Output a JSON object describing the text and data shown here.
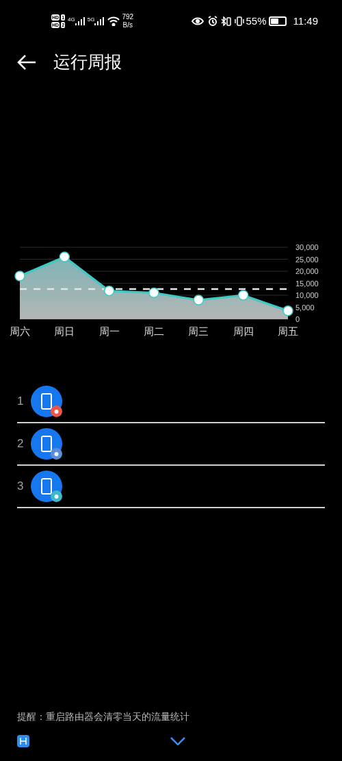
{
  "status_bar": {
    "sim": [
      {
        "label": "HD",
        "slot": "1"
      },
      {
        "label": "HD",
        "slot": "2"
      }
    ],
    "signals": [
      "4G",
      "5G"
    ],
    "speed_value": "792",
    "speed_unit": "B/s",
    "battery_text": "55%",
    "time": "11:49"
  },
  "header": {
    "title": "运行周报"
  },
  "chart_data": {
    "type": "area",
    "categories": [
      "周六",
      "周日",
      "周一",
      "周二",
      "周三",
      "周四",
      "周五"
    ],
    "grid": true,
    "series": [
      {
        "color": "#3ec9c4",
        "values": [
          18000,
          26000,
          11800,
          11000,
          8000,
          10000,
          3500
        ]
      },
      {
        "type": "line",
        "line_style": "dashed",
        "color": "#e5e5e5",
        "values": [
          12600,
          12600,
          12600,
          12600,
          12600,
          12600,
          12600
        ]
      }
    ],
    "ylim": [
      0,
      30000
    ],
    "yticks": [
      {
        "value": 0,
        "label": "0"
      },
      {
        "value": 5000,
        "label": "5,000"
      },
      {
        "value": 10000,
        "label": "10,000"
      },
      {
        "value": 15000,
        "label": "15,000"
      },
      {
        "value": 20000,
        "label": "20,000"
      },
      {
        "value": 25000,
        "label": "25,000"
      },
      {
        "value": 30000,
        "label": "30,000"
      }
    ]
  },
  "devices": [
    {
      "rank": "1",
      "color": "#e8574a"
    },
    {
      "rank": "2",
      "color": "#5a8fd8"
    },
    {
      "rank": "3",
      "color": "#3fb8c8"
    }
  ],
  "footer": {
    "note": "提醒：重启路由器会清零当天的流量统计"
  }
}
